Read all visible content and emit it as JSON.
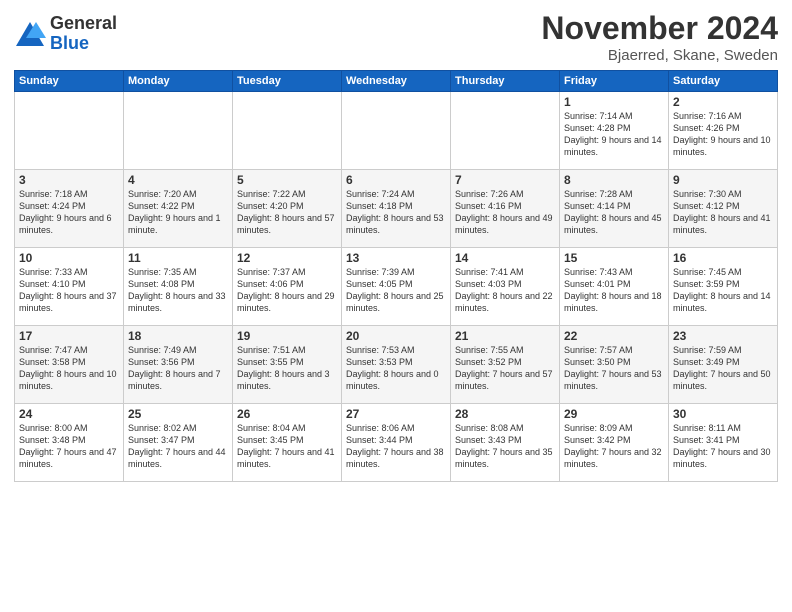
{
  "logo": {
    "general": "General",
    "blue": "Blue"
  },
  "title": "November 2024",
  "location": "Bjaerred, Skane, Sweden",
  "days_of_week": [
    "Sunday",
    "Monday",
    "Tuesday",
    "Wednesday",
    "Thursday",
    "Friday",
    "Saturday"
  ],
  "weeks": [
    [
      {
        "day": "",
        "info": ""
      },
      {
        "day": "",
        "info": ""
      },
      {
        "day": "",
        "info": ""
      },
      {
        "day": "",
        "info": ""
      },
      {
        "day": "",
        "info": ""
      },
      {
        "day": "1",
        "info": "Sunrise: 7:14 AM\nSunset: 4:28 PM\nDaylight: 9 hours and 14 minutes."
      },
      {
        "day": "2",
        "info": "Sunrise: 7:16 AM\nSunset: 4:26 PM\nDaylight: 9 hours and 10 minutes."
      }
    ],
    [
      {
        "day": "3",
        "info": "Sunrise: 7:18 AM\nSunset: 4:24 PM\nDaylight: 9 hours and 6 minutes."
      },
      {
        "day": "4",
        "info": "Sunrise: 7:20 AM\nSunset: 4:22 PM\nDaylight: 9 hours and 1 minute."
      },
      {
        "day": "5",
        "info": "Sunrise: 7:22 AM\nSunset: 4:20 PM\nDaylight: 8 hours and 57 minutes."
      },
      {
        "day": "6",
        "info": "Sunrise: 7:24 AM\nSunset: 4:18 PM\nDaylight: 8 hours and 53 minutes."
      },
      {
        "day": "7",
        "info": "Sunrise: 7:26 AM\nSunset: 4:16 PM\nDaylight: 8 hours and 49 minutes."
      },
      {
        "day": "8",
        "info": "Sunrise: 7:28 AM\nSunset: 4:14 PM\nDaylight: 8 hours and 45 minutes."
      },
      {
        "day": "9",
        "info": "Sunrise: 7:30 AM\nSunset: 4:12 PM\nDaylight: 8 hours and 41 minutes."
      }
    ],
    [
      {
        "day": "10",
        "info": "Sunrise: 7:33 AM\nSunset: 4:10 PM\nDaylight: 8 hours and 37 minutes."
      },
      {
        "day": "11",
        "info": "Sunrise: 7:35 AM\nSunset: 4:08 PM\nDaylight: 8 hours and 33 minutes."
      },
      {
        "day": "12",
        "info": "Sunrise: 7:37 AM\nSunset: 4:06 PM\nDaylight: 8 hours and 29 minutes."
      },
      {
        "day": "13",
        "info": "Sunrise: 7:39 AM\nSunset: 4:05 PM\nDaylight: 8 hours and 25 minutes."
      },
      {
        "day": "14",
        "info": "Sunrise: 7:41 AM\nSunset: 4:03 PM\nDaylight: 8 hours and 22 minutes."
      },
      {
        "day": "15",
        "info": "Sunrise: 7:43 AM\nSunset: 4:01 PM\nDaylight: 8 hours and 18 minutes."
      },
      {
        "day": "16",
        "info": "Sunrise: 7:45 AM\nSunset: 3:59 PM\nDaylight: 8 hours and 14 minutes."
      }
    ],
    [
      {
        "day": "17",
        "info": "Sunrise: 7:47 AM\nSunset: 3:58 PM\nDaylight: 8 hours and 10 minutes."
      },
      {
        "day": "18",
        "info": "Sunrise: 7:49 AM\nSunset: 3:56 PM\nDaylight: 8 hours and 7 minutes."
      },
      {
        "day": "19",
        "info": "Sunrise: 7:51 AM\nSunset: 3:55 PM\nDaylight: 8 hours and 3 minutes."
      },
      {
        "day": "20",
        "info": "Sunrise: 7:53 AM\nSunset: 3:53 PM\nDaylight: 8 hours and 0 minutes."
      },
      {
        "day": "21",
        "info": "Sunrise: 7:55 AM\nSunset: 3:52 PM\nDaylight: 7 hours and 57 minutes."
      },
      {
        "day": "22",
        "info": "Sunrise: 7:57 AM\nSunset: 3:50 PM\nDaylight: 7 hours and 53 minutes."
      },
      {
        "day": "23",
        "info": "Sunrise: 7:59 AM\nSunset: 3:49 PM\nDaylight: 7 hours and 50 minutes."
      }
    ],
    [
      {
        "day": "24",
        "info": "Sunrise: 8:00 AM\nSunset: 3:48 PM\nDaylight: 7 hours and 47 minutes."
      },
      {
        "day": "25",
        "info": "Sunrise: 8:02 AM\nSunset: 3:47 PM\nDaylight: 7 hours and 44 minutes."
      },
      {
        "day": "26",
        "info": "Sunrise: 8:04 AM\nSunset: 3:45 PM\nDaylight: 7 hours and 41 minutes."
      },
      {
        "day": "27",
        "info": "Sunrise: 8:06 AM\nSunset: 3:44 PM\nDaylight: 7 hours and 38 minutes."
      },
      {
        "day": "28",
        "info": "Sunrise: 8:08 AM\nSunset: 3:43 PM\nDaylight: 7 hours and 35 minutes."
      },
      {
        "day": "29",
        "info": "Sunrise: 8:09 AM\nSunset: 3:42 PM\nDaylight: 7 hours and 32 minutes."
      },
      {
        "day": "30",
        "info": "Sunrise: 8:11 AM\nSunset: 3:41 PM\nDaylight: 7 hours and 30 minutes."
      }
    ]
  ]
}
